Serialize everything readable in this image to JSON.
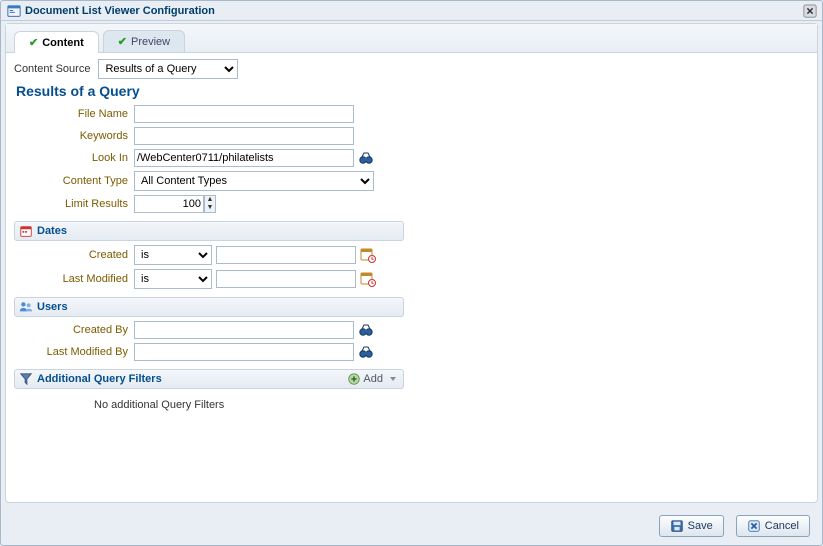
{
  "window": {
    "title": "Document List Viewer Configuration"
  },
  "tabs": {
    "content": "Content",
    "preview": "Preview",
    "active": "content"
  },
  "contentSource": {
    "label": "Content Source",
    "selected": "Results of a Query"
  },
  "resultsTitle": "Results of a Query",
  "fields": {
    "fileName": {
      "label": "File Name",
      "value": ""
    },
    "keywords": {
      "label": "Keywords",
      "value": ""
    },
    "lookIn": {
      "label": "Look In",
      "value": "/WebCenter0711/philatelists"
    },
    "contentType": {
      "label": "Content Type",
      "selected": "All Content Types"
    },
    "limitResults": {
      "label": "Limit Results",
      "value": "100"
    }
  },
  "dates": {
    "header": "Dates",
    "created": {
      "label": "Created",
      "op": "is",
      "value": ""
    },
    "lastModified": {
      "label": "Last Modified",
      "op": "is",
      "value": ""
    }
  },
  "users": {
    "header": "Users",
    "createdBy": {
      "label": "Created By",
      "value": ""
    },
    "lastModifiedBy": {
      "label": "Last Modified By",
      "value": ""
    }
  },
  "additionalFilters": {
    "header": "Additional Query Filters",
    "addLabel": "Add",
    "empty": "No additional Query Filters"
  },
  "footer": {
    "save": "Save",
    "cancel": "Cancel"
  }
}
